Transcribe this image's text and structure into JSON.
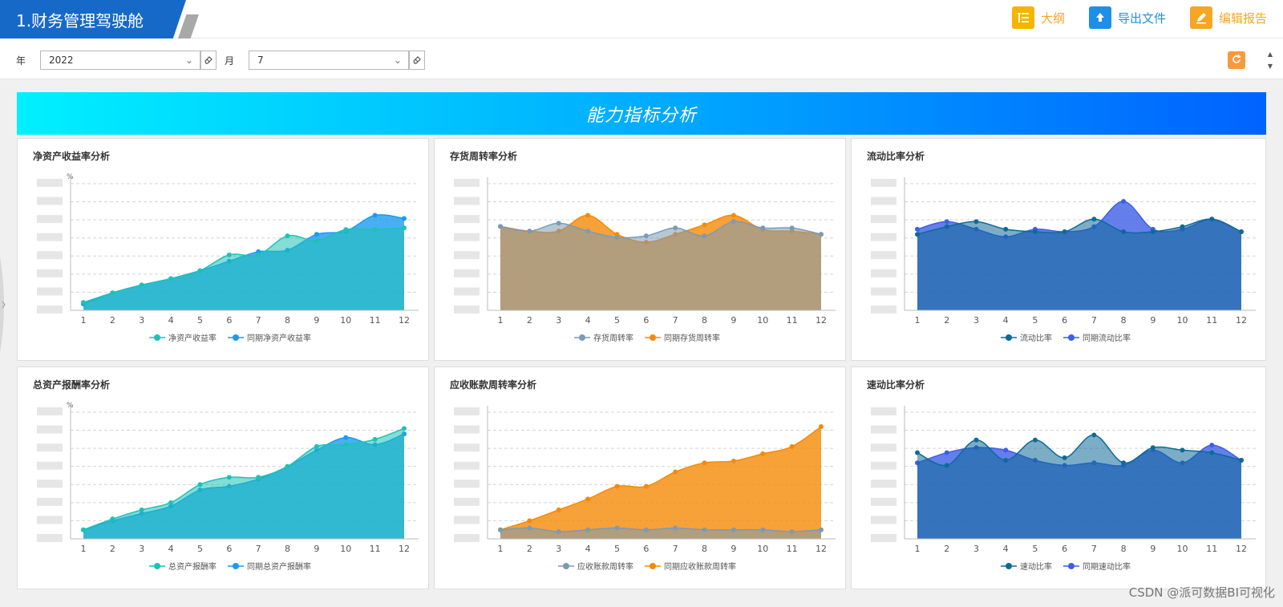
{
  "header": {
    "title": "1.财务管理驾驶舱",
    "actions": [
      {
        "label": "大纲",
        "icon": "outline-icon",
        "color": "#f5a623"
      },
      {
        "label": "导出文件",
        "icon": "export-icon",
        "color": "#1e8fe8"
      },
      {
        "label": "编辑报告",
        "icon": "edit-icon",
        "color": "#f5a623"
      }
    ]
  },
  "filters": {
    "year_label": "年",
    "year_value": "2022",
    "month_label": "月",
    "month_value": "7"
  },
  "banner": {
    "title": "能力指标分析"
  },
  "watermark": "CSDN @派可数据BI可视化",
  "colors": {
    "teal": "#1fc1b5",
    "blue": "#1a9bf0",
    "slate": "#7a9bb5",
    "orange": "#f58a07",
    "navy": "#0e6a98",
    "royal": "#3d5fe6"
  },
  "chart_data": [
    {
      "id": "roe",
      "title": "净资产收益率分析",
      "type": "area",
      "unit": "%",
      "categories": [
        "1",
        "2",
        "3",
        "4",
        "5",
        "6",
        "7",
        "8",
        "9",
        "10",
        "11",
        "12"
      ],
      "ylim": [
        0,
        8
      ],
      "series": [
        {
          "name": "净资产收益率",
          "color": "#1fc1b5",
          "values": [
            0.5,
            1.1,
            1.6,
            2.0,
            2.5,
            3.5,
            3.5,
            4.7,
            4.4,
            5.1,
            5.1,
            5.2
          ]
        },
        {
          "name": "同期净资产收益率",
          "color": "#1a9bf0",
          "values": [
            0.4,
            1.1,
            1.6,
            2.0,
            2.5,
            3.1,
            3.7,
            3.8,
            4.8,
            5.0,
            6.0,
            5.8
          ]
        }
      ]
    },
    {
      "id": "inventory",
      "title": "存货周转率分析",
      "type": "area",
      "categories": [
        "1",
        "2",
        "3",
        "4",
        "5",
        "6",
        "7",
        "8",
        "9",
        "10",
        "11",
        "12"
      ],
      "ylim": [
        0,
        8
      ],
      "series": [
        {
          "name": "存货周转率",
          "color": "#7a9bb5",
          "values": [
            5.3,
            5.0,
            5.5,
            5.0,
            4.6,
            4.7,
            5.2,
            4.7,
            5.6,
            5.2,
            5.2,
            4.8
          ]
        },
        {
          "name": "同期存货周转率",
          "color": "#f58a07",
          "values": [
            5.3,
            5.0,
            5.0,
            6.0,
            4.8,
            4.3,
            4.8,
            5.4,
            6.0,
            5.1,
            5.0,
            4.8
          ]
        }
      ]
    },
    {
      "id": "current",
      "title": "流动比率分析",
      "type": "area",
      "categories": [
        "1",
        "2",
        "3",
        "4",
        "5",
        "6",
        "7",
        "8",
        "9",
        "10",
        "11",
        "12"
      ],
      "ylim": [
        0,
        5
      ],
      "series": [
        {
          "name": "流动比率",
          "color": "#0e6a98",
          "values": [
            3.0,
            3.3,
            3.5,
            3.2,
            3.1,
            3.1,
            3.6,
            3.1,
            3.1,
            3.3,
            3.6,
            3.1
          ]
        },
        {
          "name": "同期流动比率",
          "color": "#3d5fe6",
          "values": [
            3.2,
            3.5,
            3.2,
            2.9,
            3.2,
            3.1,
            3.3,
            4.3,
            3.2,
            3.2,
            3.6,
            3.1
          ]
        }
      ]
    },
    {
      "id": "roa",
      "title": "总资产报酬率分析",
      "type": "area",
      "unit": "%",
      "categories": [
        "1",
        "2",
        "3",
        "4",
        "5",
        "6",
        "7",
        "8",
        "9",
        "10",
        "11",
        "12"
      ],
      "ylim": [
        0,
        7
      ],
      "series": [
        {
          "name": "总资产报酬率",
          "color": "#1fc1b5",
          "values": [
            0.5,
            1.1,
            1.6,
            2.0,
            3.0,
            3.4,
            3.4,
            4.0,
            5.1,
            5.2,
            5.5,
            6.1
          ]
        },
        {
          "name": "同期总资产报酬率",
          "color": "#1a9bf0",
          "values": [
            0.5,
            1.0,
            1.4,
            1.8,
            2.7,
            2.9,
            3.3,
            4.0,
            4.9,
            5.6,
            5.2,
            5.8
          ]
        }
      ]
    },
    {
      "id": "receivable",
      "title": "应收账款周转率分析",
      "type": "area",
      "categories": [
        "1",
        "2",
        "3",
        "4",
        "5",
        "6",
        "7",
        "8",
        "9",
        "10",
        "11",
        "12"
      ],
      "ylim": [
        0,
        7
      ],
      "series": [
        {
          "name": "应收账款周转率",
          "color": "#7a9bb5",
          "values": [
            0.5,
            0.6,
            0.4,
            0.5,
            0.6,
            0.5,
            0.6,
            0.5,
            0.5,
            0.5,
            0.4,
            0.5
          ]
        },
        {
          "name": "同期应收账款周转率",
          "color": "#f58a07",
          "values": [
            0.5,
            1.0,
            1.6,
            2.2,
            2.9,
            2.9,
            3.7,
            4.2,
            4.3,
            4.7,
            5.1,
            6.2
          ]
        }
      ]
    },
    {
      "id": "quick",
      "title": "速动比率分析",
      "type": "area",
      "categories": [
        "1",
        "2",
        "3",
        "4",
        "5",
        "6",
        "7",
        "8",
        "9",
        "10",
        "11",
        "12"
      ],
      "ylim": [
        0,
        5
      ],
      "series": [
        {
          "name": "速动比率",
          "color": "#0e6a98",
          "values": [
            3.4,
            2.9,
            3.9,
            3.1,
            3.9,
            3.2,
            4.1,
            3.0,
            3.6,
            3.5,
            3.4,
            3.1
          ]
        },
        {
          "name": "同期速动比率",
          "color": "#3d5fe6",
          "values": [
            3.0,
            3.4,
            3.6,
            3.5,
            3.1,
            2.9,
            3.0,
            2.9,
            3.5,
            3.0,
            3.7,
            3.1
          ]
        }
      ]
    }
  ]
}
